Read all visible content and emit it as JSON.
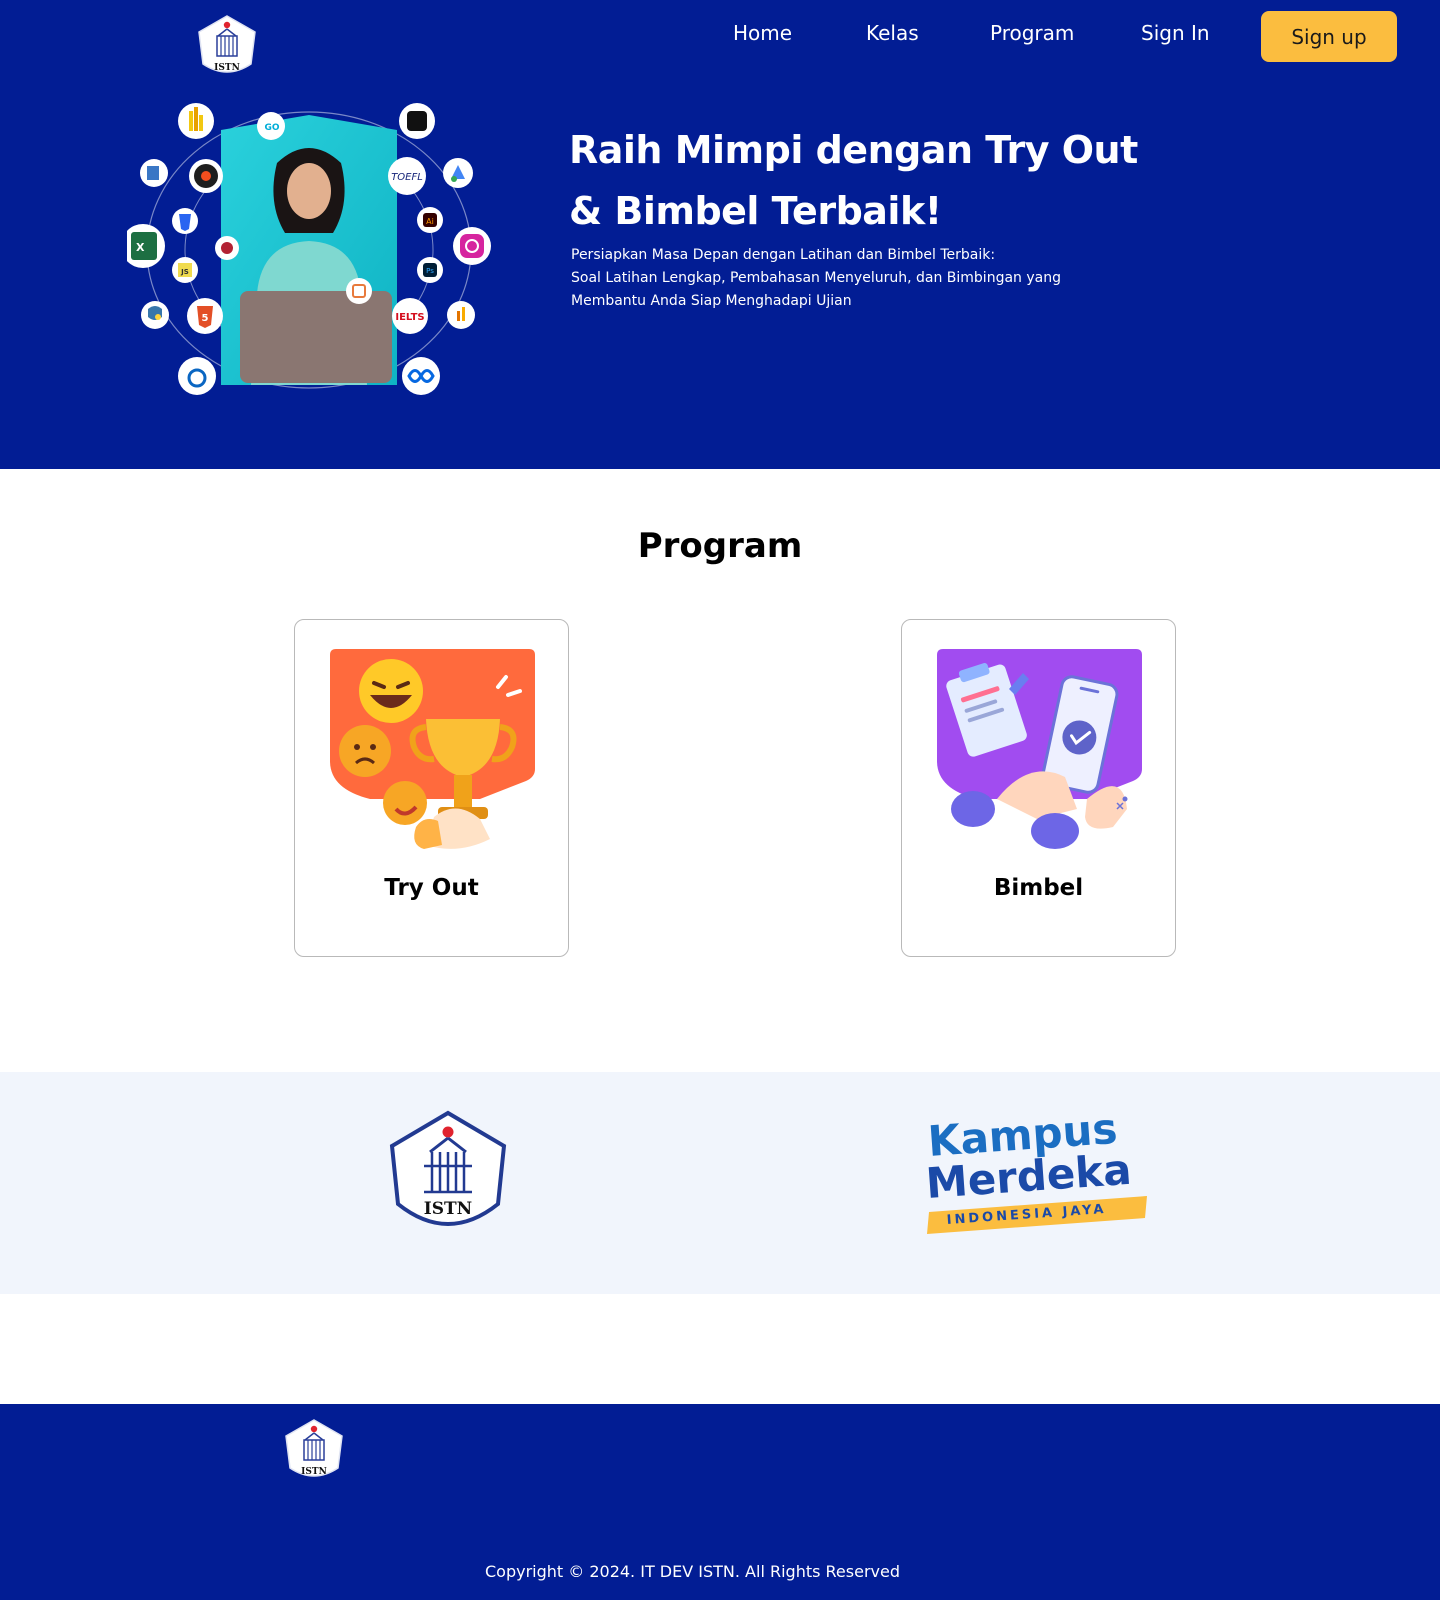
{
  "brand": {
    "logo_text": "ISTN",
    "colors": {
      "primary": "#021d94",
      "accent": "#fbbd3f",
      "partners_bg": "#f1f5fc"
    }
  },
  "nav": {
    "items": [
      {
        "label": "Home"
      },
      {
        "label": "Kelas"
      },
      {
        "label": "Program"
      },
      {
        "label": "Sign In"
      }
    ],
    "signup_label": "Sign up"
  },
  "hero": {
    "title_line1": "Raih Mimpi dengan Try Out",
    "title_line2": "& Bimbel Terbaik!",
    "subtitle_line1": "Persiapkan Masa Depan dengan Latihan dan Bimbel Terbaik:",
    "subtitle_line2": "Soal Latihan Lengkap, Pembahasan Menyeluruh, dan Bimbingan yang",
    "subtitle_line3": "Membantu Anda Siap Menghadapi Ujian",
    "illustration_badges": [
      "GO",
      "TOEFL",
      "IELTS",
      "X",
      "JS",
      "Ai",
      "Ps",
      "5"
    ]
  },
  "program": {
    "title": "Program",
    "cards": [
      {
        "label": "Try Out",
        "icon": "trophy-icon"
      },
      {
        "label": "Bimbel",
        "icon": "checklist-phone-icon"
      }
    ]
  },
  "partners": {
    "istn_text": "ISTN",
    "kampus_merdeka_line1": "Kampus",
    "kampus_merdeka_line2": "Merdeka",
    "kampus_merdeka_tagline": "INDONESIA JAYA"
  },
  "footer": {
    "copyright": "Copyright © 2024. IT DEV ISTN. All Rights Reserved"
  }
}
